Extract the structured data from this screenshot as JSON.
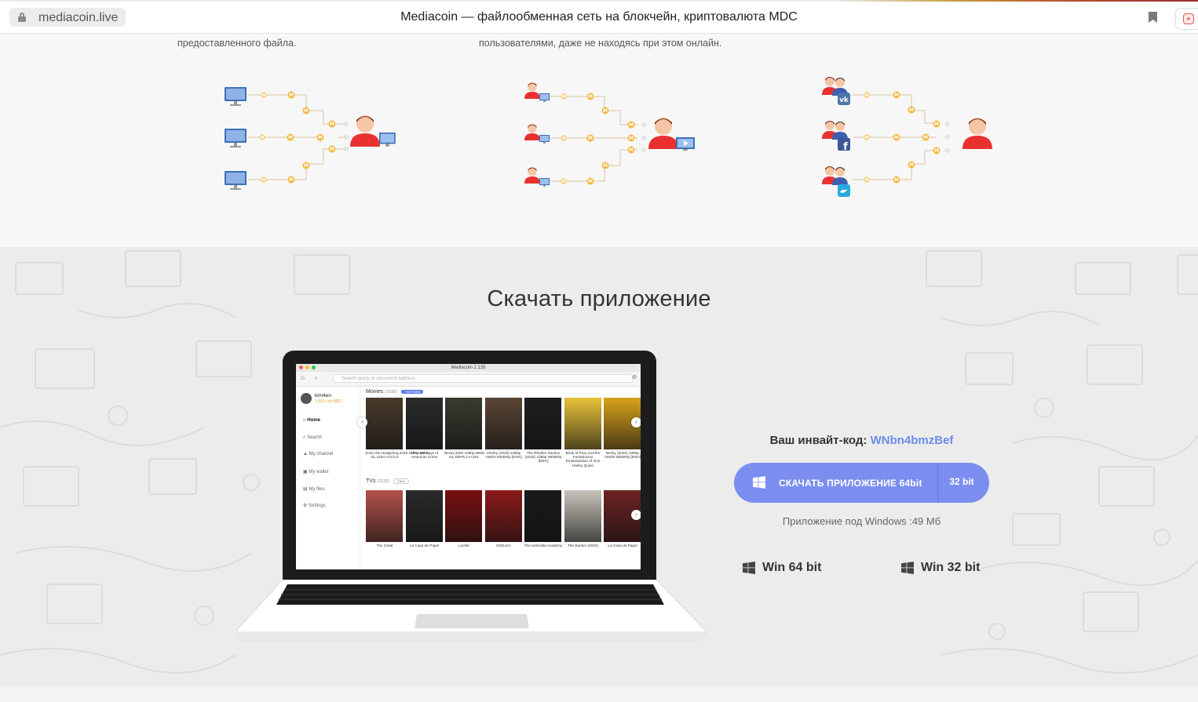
{
  "browser": {
    "url": "mediacoin.live",
    "title": "Mediacoin — файлообменная сеть на блокчейн, криптовалюта MDC"
  },
  "upper": {
    "col1_text": "предоставленного файла.",
    "col2_text": "пользователями, даже не находясь при этом онлайн."
  },
  "download": {
    "title": "Скачать приложение",
    "invite_label": "Ваш инвайт-код:",
    "invite_code": "WNbn4bmzBef",
    "button_label": "СКАЧАТЬ ПРИЛОЖЕНИЕ 64bit",
    "button_alt_label": "32 bit",
    "note": "Приложение под Windows :49 Мб",
    "win64_label": "Win 64 bit",
    "win32_label": "Win 32 bit"
  },
  "app_mock": {
    "window_title": "Mediacoin 2.135",
    "search_placeholder": "Search query or document address",
    "user_name": "kim4en",
    "user_balance": "1 821, n/a MDC",
    "nav": [
      "Home",
      "Search",
      "My channel",
      "My wallet",
      "My files",
      "Settings"
    ],
    "movies_header": "Movies",
    "movies_count": "(2180)",
    "movies_badge": "+324 New",
    "tvs_header": "TVs",
    "tvs_count": "(1132)",
    "tvs_badge": "View",
    "movies": [
      {
        "title": "Sonic.the.Hedgehog.2020.1080p.WEB-DL.x264.AAC2.0",
        "color": "#4a3a2c"
      },
      {
        "title": "The Last Days of American Crime",
        "color": "#2b2b2b"
      },
      {
        "title": "Becky.2020.1080p.WEB-DL.DDP5.1.H.264",
        "color": "#3a3a30"
      },
      {
        "title": "Shirley (2020) 1080p AMZN WEBRip [ENG]",
        "color": "#5a4636"
      },
      {
        "title": "The Rhythm Section (2020) 1080p WEBRip [ENG]",
        "color": "#1e1e1e"
      },
      {
        "title": "Birds of Prey And the Fantabulous Emancipation of One Harley Quinn",
        "color": "#e8c23a"
      },
      {
        "title": "Becky (2020) 1080p AMZN WEBRip [ENG]",
        "color": "#d9a21c"
      }
    ],
    "tvs": [
      {
        "title": "The Great",
        "color": "#b5524a"
      },
      {
        "title": "La Casa de Papel",
        "color": "#2a2a2a"
      },
      {
        "title": "Lucifer",
        "color": "#7a0f0f"
      },
      {
        "title": "NOS4A2",
        "color": "#8c1a1a"
      },
      {
        "title": "The Umbrella Academy",
        "color": "#1a1a1a"
      },
      {
        "title": "The Banker (2020)",
        "color": "#c9c4bb"
      },
      {
        "title": "La Casa de Papel",
        "color": "#6d2222"
      }
    ]
  },
  "colors": {
    "accent_button": "#7b8ef0",
    "invite_code": "#6b8ee8",
    "coin": "#f5b83d",
    "avatar": "#e8312f"
  }
}
